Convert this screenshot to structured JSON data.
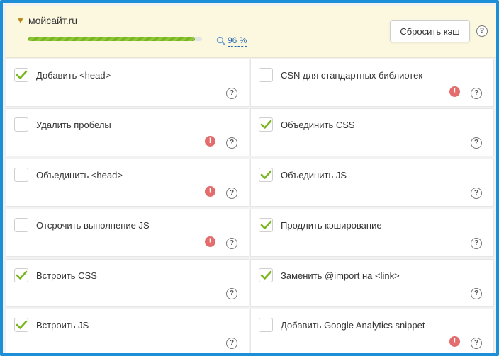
{
  "header": {
    "site_name": "мойсайт.ru",
    "score_text": "96 %",
    "score": 96,
    "reset_label": "Сбросить кэш",
    "help": "?"
  },
  "colors": {
    "frame": "#1e8fd6",
    "header_bg": "#fcf8e0",
    "progress": "#7ab51d",
    "check": "#7ab51d",
    "warning": "#e46c6c"
  },
  "options": [
    {
      "label": "Добавить <head>",
      "checked": true,
      "warning": false,
      "help": "?"
    },
    {
      "label": "CSN для стандартных библиотек",
      "checked": false,
      "warning": true,
      "warning_glyph": "!",
      "help": "?"
    },
    {
      "label": "Удалить пробелы",
      "checked": false,
      "warning": true,
      "warning_glyph": "!",
      "help": "?"
    },
    {
      "label": "Объединить CSS",
      "checked": true,
      "warning": false,
      "help": "?"
    },
    {
      "label": "Объединить <head>",
      "checked": false,
      "warning": true,
      "warning_glyph": "!",
      "help": "?"
    },
    {
      "label": "Объединить JS",
      "checked": true,
      "warning": false,
      "help": "?"
    },
    {
      "label": "Отсрочить выполнение JS",
      "checked": false,
      "warning": true,
      "warning_glyph": "!",
      "help": "?"
    },
    {
      "label": "Продлить кэширование",
      "checked": true,
      "warning": false,
      "help": "?"
    },
    {
      "label": "Встроить CSS",
      "checked": true,
      "warning": false,
      "help": "?"
    },
    {
      "label": "Заменить @import на <link>",
      "checked": true,
      "warning": false,
      "help": "?"
    },
    {
      "label": "Встроить JS",
      "checked": true,
      "warning": false,
      "help": "?"
    },
    {
      "label": "Добавить Google Analytics snippet",
      "checked": false,
      "warning": true,
      "warning_glyph": "!",
      "help": "?"
    }
  ]
}
